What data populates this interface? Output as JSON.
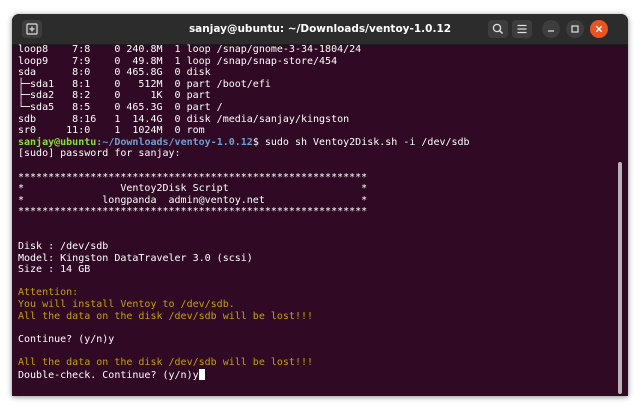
{
  "window": {
    "title": "sanjay@ubuntu: ~/Downloads/ventoy-1.0.12"
  },
  "icons": {
    "new_tab": "new-tab-icon",
    "search": "search-icon",
    "menu": "hamburger-menu-icon",
    "minimize": "minimize-icon",
    "maximize": "maximize-icon",
    "close": "close-icon"
  },
  "colors": {
    "terminal_bg": "#300a24",
    "titlebar_bg": "#2c2c2c",
    "prompt_user": "#8ae234",
    "prompt_path": "#729fcf",
    "warning": "#c4a000",
    "close_button": "#e95420"
  },
  "terminal": {
    "lsblk": [
      "loop8    7:8    0 240.8M  1 loop /snap/gnome-3-34-1804/24",
      "loop9    7:9    0  49.8M  1 loop /snap/snap-store/454",
      "sda      8:0    0 465.8G  0 disk",
      "├─sda1   8:1    0   512M  0 part /boot/efi",
      "├─sda2   8:2    0     1K  0 part",
      "└─sda5   8:5    0 465.3G  0 part /",
      "sdb      8:16   1  14.4G  0 disk /media/sanjay/kingston",
      "sr0     11:0    1  1024M  0 rom"
    ],
    "prompt": {
      "user": "sanjay@ubuntu",
      "path": ":~/Downloads/ventoy-1.0.12",
      "command": "$ sudo sh Ventoy2Disk.sh -i /dev/sdb"
    },
    "sudo_prompt": "[sudo] password for sanjay:",
    "banner": [
      "**********************************************************",
      "*                Ventoy2Disk Script                      *",
      "*             longpanda  admin@ventoy.net                *",
      "**********************************************************"
    ],
    "disk_info": [
      "Disk : /dev/sdb",
      "Model: Kingston DataTraveler 3.0 (scsi)",
      "Size : 14 GB"
    ],
    "attention": [
      "Attention:",
      "You will install Ventoy to /dev/sdb.",
      "All the data on the disk /dev/sdb will be lost!!!"
    ],
    "continue_prompt": "Continue? (y/n)y",
    "second_warning": "All the data on the disk /dev/sdb will be lost!!!",
    "double_check": "Double-check. Continue? (y/n)y"
  }
}
